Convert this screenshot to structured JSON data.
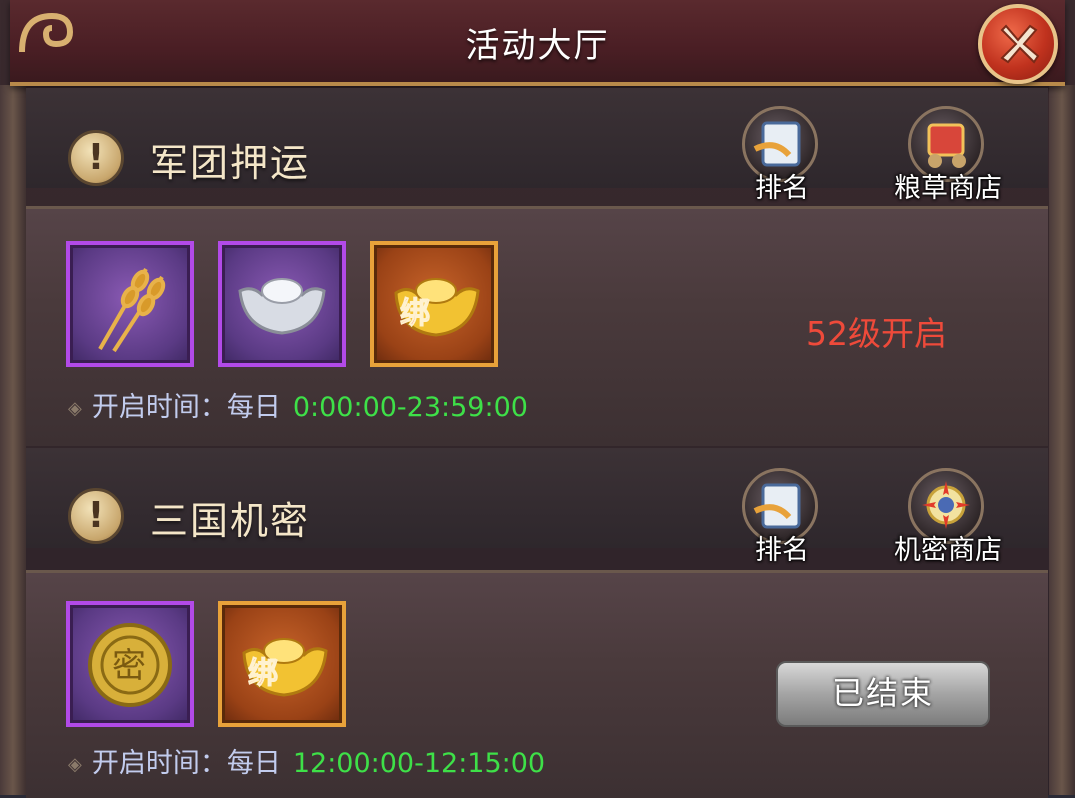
{
  "window": {
    "title": "活动大厅"
  },
  "activities": [
    {
      "name": "军团押运",
      "buttons": [
        "排名",
        "粮草商店"
      ],
      "rewards": [
        {
          "icon": "wheat-icon",
          "rarity": "purple"
        },
        {
          "icon": "silver-ingot-icon",
          "rarity": "purple"
        },
        {
          "icon": "bound-gold-ingot-icon",
          "rarity": "orange",
          "badge": "绑"
        }
      ],
      "time_label": "开启时间：",
      "time_freq": "每日",
      "time_range": "0:00:00-23:59:00",
      "status": "52级开启"
    },
    {
      "name": "三国机密",
      "buttons": [
        "排名",
        "机密商店"
      ],
      "rewards": [
        {
          "icon": "secret-coin-icon",
          "rarity": "purple",
          "badge": "密"
        },
        {
          "icon": "bound-gold-ingot-icon",
          "rarity": "orange",
          "badge": "绑"
        }
      ],
      "time_label": "开启时间：",
      "time_freq": "每日",
      "time_range": "12:00:00-12:15:00",
      "status": "已结束"
    }
  ],
  "colors": {
    "time_value": "#3ee048",
    "level_requirement": "#ee4a3a",
    "purple_frame": "#b24ae8",
    "orange_frame": "#e8a23a"
  }
}
